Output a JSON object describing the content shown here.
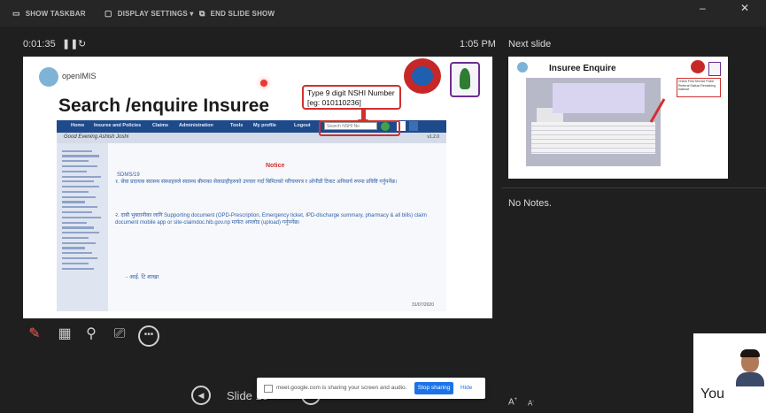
{
  "topbar": {
    "show_taskbar": "SHOW TASKBAR",
    "display_settings": "DISPLAY SETTINGS ▾",
    "end_slide_show": "END SLIDE SHOW"
  },
  "presenter": {
    "timer": "0:01:35",
    "clock": "1:05 PM",
    "next_slide_label": "Next slide",
    "notes": "No Notes.",
    "slide_counter": "Slide 10"
  },
  "slide": {
    "logo_text": "openIMIS",
    "title": "Search /enquire Insuree",
    "callout": "Type 9 digit NSHI Number [eg: 010110236]",
    "screenshot": {
      "menu": [
        "Home",
        "Insuree and Policies",
        "Claims",
        "Administration",
        "Tools",
        "My profile",
        "Logout"
      ],
      "search_placeholder": "Search NSHI No",
      "greeting": "Good Evening Ashish Joshi",
      "version": "v1.2.0",
      "notice_title": "Notice",
      "notice_id": "SDMS/19",
      "paragraph1": "१. सेवा प्रदायक स्वास्थ्य संस्थाहरुले स्वास्थ्य बीमाका सेवाग्राहीहरुको उपचार गर्दा बिमितको परिचयपत्र र ओपीडी टिकट अनिवार्य रुपमा प्रविष्टि गर्नुपर्नेछ।",
      "paragraph2": "२. दाबी भुक्तानीका लागि Supporting document (OPD-Prescription, Emergency ticket, IPD-discharge summary, pharmacy & all bills) claim document mobile app or site-claimdoc.hib.gov.np मार्फत अपलोड (upload) गर्नुपर्नेछ।",
      "signature": "- आई. टि शाखा",
      "date": "31/07/2020"
    }
  },
  "next_slide": {
    "title": "Insuree Enquire",
    "note": "Check First Service Point/ Referral Status/ Remaining balance"
  },
  "share_bar": {
    "message": "meet.google.com is sharing your screen and audio.",
    "stop_label": "Stop sharing",
    "hide_label": "Hide"
  },
  "participant": {
    "label": "You"
  },
  "colors": {
    "accent_red": "#d32f2f",
    "nav_blue": "#1e4a8a",
    "share_blue": "#1a73e8",
    "pen_red": "#ff5a4e"
  },
  "icons": [
    "taskbar-icon",
    "display-icon",
    "end-show-icon",
    "pause-icon",
    "reset-icon",
    "pen-icon",
    "slides-grid-icon",
    "zoom-icon",
    "subtitles-icon",
    "more-options-icon",
    "prev-slide-icon",
    "next-slide-icon",
    "font-decrease-icon",
    "font-increase-icon",
    "user-avatar-icon"
  ]
}
